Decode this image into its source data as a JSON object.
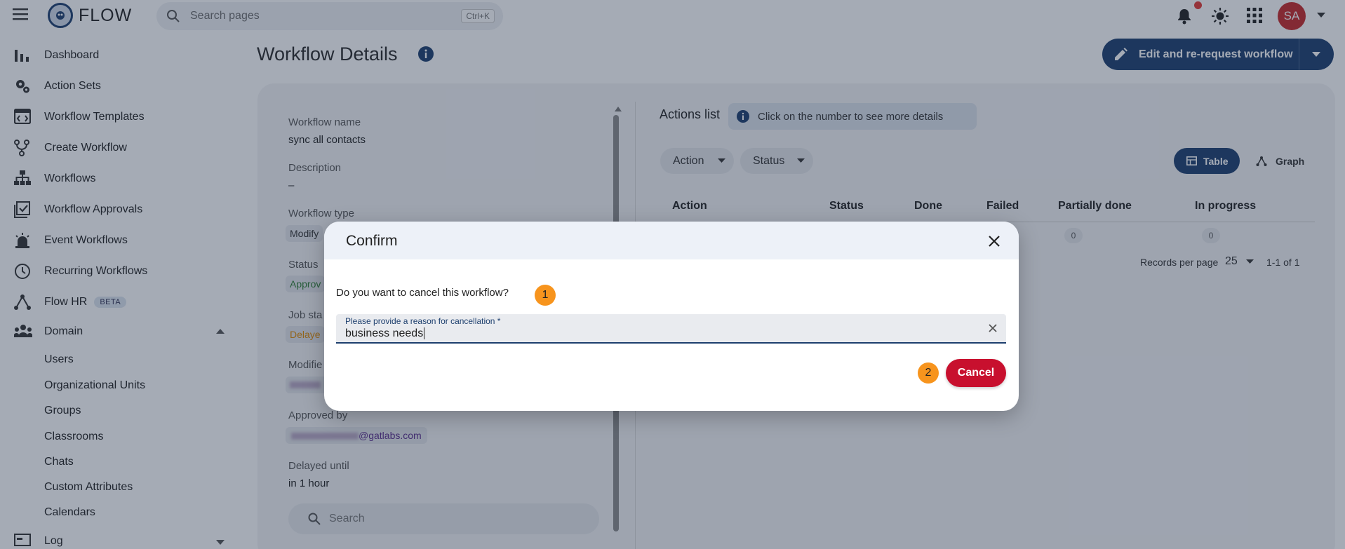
{
  "app": {
    "name": "FLOW"
  },
  "search": {
    "placeholder": "Search pages",
    "shortcut": "Ctrl+K"
  },
  "topbar": {
    "avatar_initials": "SA",
    "icons": [
      "bell-icon",
      "sun-icon",
      "apps-grid-icon"
    ]
  },
  "sidebar": {
    "items": [
      {
        "label": "Dashboard",
        "icon": "bar-chart-icon"
      },
      {
        "label": "Action Sets",
        "icon": "gears-icon"
      },
      {
        "label": "Workflow Templates",
        "icon": "template-icon"
      },
      {
        "label": "Create Workflow",
        "icon": "fork-icon"
      },
      {
        "label": "Workflows",
        "icon": "hierarchy-icon"
      },
      {
        "label": "Workflow Approvals",
        "icon": "checklist-icon"
      },
      {
        "label": "Event Workflows",
        "icon": "alarm-icon"
      },
      {
        "label": "Recurring Workflows",
        "icon": "clock-icon"
      },
      {
        "label": "Flow HR",
        "badge": "BETA",
        "icon": "network-icon"
      },
      {
        "label": "Domain",
        "icon": "people-icon"
      }
    ],
    "domain_sub": [
      "Users",
      "Organizational Units",
      "Groups",
      "Classrooms",
      "Chats",
      "Custom Attributes",
      "Calendars"
    ],
    "log": "Log"
  },
  "page": {
    "title": "Workflow Details",
    "edit_button": "Edit and re-request workflow"
  },
  "details": {
    "workflow_name_label": "Workflow name",
    "workflow_name": "sync all contacts",
    "description_label": "Description",
    "description": "–",
    "workflow_type_label": "Workflow type",
    "workflow_type": "Modify",
    "status_label": "Status",
    "status": "Approv",
    "job_status_label": "Job sta",
    "job_status": "Delaye",
    "modified_label": "Modifie",
    "approved_by_label": "Approved by",
    "approved_by": "@gatlabs.com",
    "delayed_until_label": "Delayed until",
    "delayed_until": "in 1 hour",
    "search_placeholder": "Search"
  },
  "actions": {
    "title": "Actions list",
    "hint": "Click on the number to see more details",
    "filters": [
      "Action",
      "Status"
    ],
    "view_table": "Table",
    "view_graph": "Graph",
    "columns": [
      "Action",
      "Status",
      "Done",
      "Failed",
      "Partially done",
      "In progress"
    ],
    "row_values": {
      "partially_done": "0",
      "in_progress": "0"
    },
    "records_per_page_label": "Records per page",
    "records_per_page": "25",
    "range": "1-1 of 1"
  },
  "dialog": {
    "title": "Confirm",
    "question": "Do you want to cancel this workflow?",
    "step1": "1",
    "field_label": "Please provide a reason for cancellation *",
    "field_value": "business needs",
    "step2": "2",
    "cancel_button": "Cancel"
  },
  "colors": {
    "primary": "#1d3f6e",
    "danger": "#c8102e",
    "step_badge": "#f7941d",
    "status_approved": "#2e7d32",
    "status_delayed": "#e08a00"
  }
}
